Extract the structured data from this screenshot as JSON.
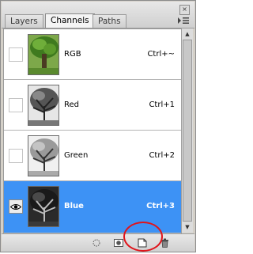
{
  "tabs": [
    {
      "label": "Layers"
    },
    {
      "label": "Channels"
    },
    {
      "label": "Paths"
    }
  ],
  "channels": [
    {
      "name": "RGB",
      "shortcut": "Ctrl+~"
    },
    {
      "name": "Red",
      "shortcut": "Ctrl+1"
    },
    {
      "name": "Green",
      "shortcut": "Ctrl+2"
    },
    {
      "name": "Blue",
      "shortcut": "Ctrl+3"
    }
  ],
  "selected_channel": "Blue",
  "close_glyph": "×",
  "menu_glyph": "▸≡",
  "colors": {
    "selection": "#3d92f5",
    "highlight_circle": "#e0141b"
  },
  "bottom_buttons": [
    {
      "icon": "load-selection-icon"
    },
    {
      "icon": "save-selection-icon"
    },
    {
      "icon": "new-channel-icon"
    },
    {
      "icon": "trash-icon"
    }
  ]
}
